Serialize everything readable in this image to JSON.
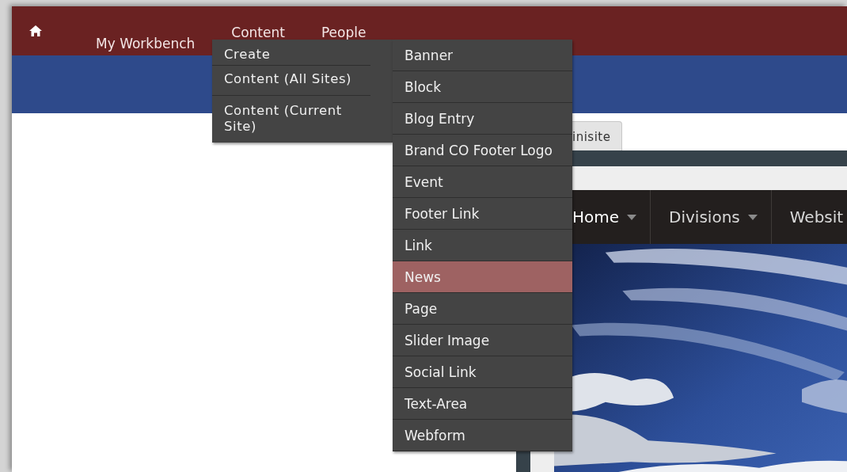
{
  "top_bar": {
    "items": [
      "My Workbench",
      "Content",
      "People"
    ]
  },
  "content_menu": {
    "items": [
      "Create",
      "Content (All Sites)",
      "Content (Current Site)"
    ]
  },
  "create_menu": {
    "items": [
      {
        "label": "Banner",
        "selected": false
      },
      {
        "label": "Block",
        "selected": false
      },
      {
        "label": "Blog Entry",
        "selected": false
      },
      {
        "label": "Brand CO Footer Logo",
        "selected": false
      },
      {
        "label": "Event",
        "selected": false
      },
      {
        "label": "Footer Link",
        "selected": false
      },
      {
        "label": "Link",
        "selected": false
      },
      {
        "label": "News",
        "selected": true
      },
      {
        "label": "Page",
        "selected": false
      },
      {
        "label": "Slider Image",
        "selected": false
      },
      {
        "label": "Social Link",
        "selected": false
      },
      {
        "label": "Text-Area",
        "selected": false
      },
      {
        "label": "Webform",
        "selected": false
      }
    ]
  },
  "preview": {
    "tab": "inisite",
    "nav": [
      {
        "label": "Home",
        "selected": true
      },
      {
        "label": "Divisions",
        "selected": false
      },
      {
        "label": "Websit",
        "selected": false
      }
    ]
  }
}
